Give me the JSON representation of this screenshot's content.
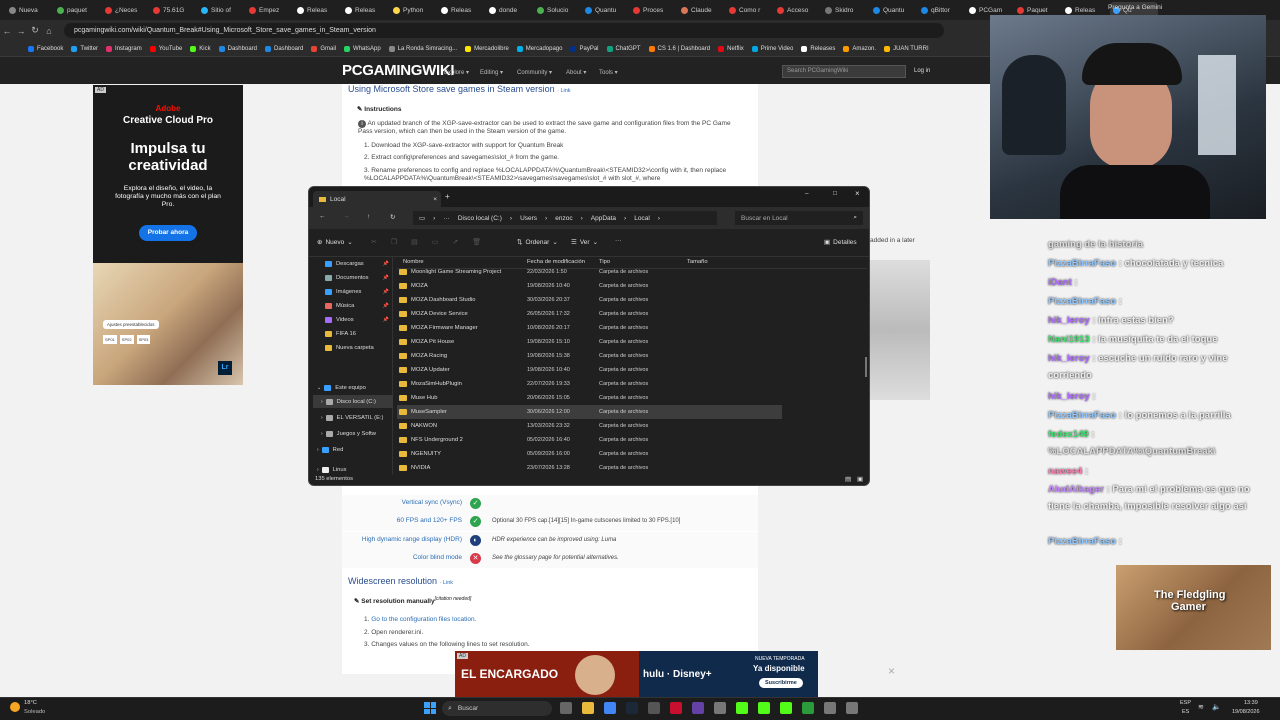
{
  "browser": {
    "tabs": [
      "Nueva",
      "paquet",
      "¿Neces",
      "75.61G",
      "Sitio of",
      "Empez",
      "Releas",
      "Releas",
      "Python",
      "Releas",
      "donde",
      "Solucio",
      "Quantu",
      "Proces",
      "Claude",
      "Como r",
      "Acceso",
      "Skidro",
      "Quantu",
      "qBittor",
      "PCGam",
      "Paquet",
      "Releas",
      "Qu"
    ],
    "gemini": "Pregunta a Gemini",
    "url": "pcgamingwiki.com/wiki/Quantum_Break#Using_Microsoft_Store_save_games_in_Steam_version",
    "bookmarks": [
      "Facebook",
      "Twitter",
      "Instagram",
      "YouTube",
      "Kick",
      "Dashboard",
      "Dashboard",
      "Gmail",
      "WhatsApp",
      "La Ronda Simracing...",
      "Mercadolibre",
      "Mercadopago",
      "PayPal",
      "ChatGPT",
      "CS 1.6 | Dashboard",
      "Netflix",
      "Prime Video",
      "Releases",
      "Amazon.",
      "JUAN TURRI"
    ]
  },
  "site": {
    "logo": "PCGAMINGWIKI",
    "nav": [
      "Explore ▾",
      "Editing ▾",
      "Community ▾",
      "About ▾",
      "Tools ▾"
    ],
    "search_placeholder": "Search PCGamingWiki",
    "login": "Log in"
  },
  "article": {
    "section_title": "Using Microsoft Store save games in Steam version",
    "section_link": "· Link",
    "instructions_title": "Instructions",
    "info": "An updated branch of the XGP-save-extractor can be used to extract the save game and configuration files from the PC Game Pass version, which can then be used in the Steam version of the game.",
    "steps": [
      "Download the XGP-save-extractor with support for Quantum Break",
      "Extract config\\preferences and savegames\\slot_# from the game.",
      "Rename preferences to config and replace %LOCALAPPDATA%\\QuantumBreak\\<STEAMID32>\\config with it, then replace %LOCALAPPDATA%\\QuantumBreak\\<STEAMID32>\\savegames\\savegames\\slot_# with slot_#, where"
    ],
    "side_note": "added in a later",
    "rows": [
      {
        "label": "Vertical sync (Vsync)",
        "icon": "check",
        "note": ""
      },
      {
        "label": "60 FPS and 120+ FPS",
        "icon": "check",
        "note": "Optional 30 FPS cap.[14][15] In-game cutscenes limited to 30 FPS.[10]"
      },
      {
        "label": "High dynamic range display (HDR)",
        "icon": "hackable",
        "note": "HDR experience can be improved using: Luma"
      },
      {
        "label": "Color blind mode",
        "icon": "cross",
        "note": "See the glossary page for potential alternatives."
      }
    ],
    "widescreen_title": "Widescreen resolution",
    "widescreen_link": "· Link",
    "set_res_title": "Set resolution manually",
    "citation": "[citation needed]",
    "ws_steps": [
      "Go to the configuration files location.",
      "Open renderer.ini.",
      "Changes values on the following lines to set resolution."
    ]
  },
  "adobe_ad": {
    "badge": "AD",
    "brand": "Adobe",
    "product": "Creative Cloud Pro",
    "headline1": "Impulsa tu",
    "headline2": "creatividad",
    "body": "Explora el diseño, el video, la fotografía y mucho más con el plan Pro.",
    "cta": "Probar ahora",
    "overlay": "Ajustes preestablecidos",
    "presets": [
      "SP01",
      "SP02",
      "SP03"
    ],
    "lr": "Lr"
  },
  "explorer": {
    "title": "Local",
    "breadcrumb": [
      "Disco local (C:)",
      "Users",
      "enzoc",
      "AppData",
      "Local"
    ],
    "search_placeholder": "Buscar en Local",
    "toolbar": {
      "new": "Nuevo",
      "sort": "Ordenar",
      "view": "Ver",
      "details": "Detalles"
    },
    "columns": [
      "Nombre",
      "Fecha de modificación",
      "Tipo",
      "Tamaño"
    ],
    "quick_access": [
      "Descargas",
      "Documentos",
      "Imágenes",
      "Música",
      "Videos",
      "FIFA 16",
      "Nueva carpeta"
    ],
    "tree": [
      "Este equipo",
      "Disco local (C:)",
      "EL VERSATIL (E:)",
      "Juegos y Softw",
      "Red",
      "Linux"
    ],
    "files": [
      {
        "name": "Moonlight Game Streaming Project",
        "date": "22/03/2026 1:50",
        "type": "Carpeta de archivos"
      },
      {
        "name": "MOZA",
        "date": "19/08/2026 10:40",
        "type": "Carpeta de archivos"
      },
      {
        "name": "MOZA Dashboard Studio",
        "date": "30/03/2026 20:37",
        "type": "Carpeta de archivos"
      },
      {
        "name": "MOZA Device Service",
        "date": "26/05/2026 17:32",
        "type": "Carpeta de archivos"
      },
      {
        "name": "MOZA Firmware Manager",
        "date": "10/08/2026 20:17",
        "type": "Carpeta de archivos"
      },
      {
        "name": "MOZA Pit House",
        "date": "19/08/2026 15:10",
        "type": "Carpeta de archivos"
      },
      {
        "name": "MOZA Racing",
        "date": "19/08/2026 15:38",
        "type": "Carpeta de archivos"
      },
      {
        "name": "MOZA Updater",
        "date": "19/08/2026 10:40",
        "type": "Carpeta de archivos"
      },
      {
        "name": "MozaSimHubPlugin",
        "date": "22/07/2026 19:33",
        "type": "Carpeta de archivos"
      },
      {
        "name": "Muse Hub",
        "date": "20/06/2026 15:05",
        "type": "Carpeta de archivos"
      },
      {
        "name": "MuseSampler",
        "date": "30/06/2026 12:00",
        "type": "Carpeta de archivos"
      },
      {
        "name": "NAKWON",
        "date": "13/03/2026 23:32",
        "type": "Carpeta de archivos"
      },
      {
        "name": "NFS Underground 2",
        "date": "05/02/2026 16:40",
        "type": "Carpeta de archivos"
      },
      {
        "name": "NGENUITY",
        "date": "05/09/2026 16:00",
        "type": "Carpeta de archivos"
      },
      {
        "name": "NVIDIA",
        "date": "23/07/2026 13:28",
        "type": "Carpeta de archivos"
      }
    ],
    "status": "135 elementos"
  },
  "chat": [
    {
      "user": "",
      "text": "gaming de la historia",
      "color": "#dddddd"
    },
    {
      "user": "PizzaBirraFaso",
      "text": ": chocolatada y tecnica",
      "color": "#8fc7ff"
    },
    {
      "user": "iDant",
      "text": ":",
      "color": "#b06cff"
    },
    {
      "user": "PizzaBirraFaso",
      "text": ":",
      "color": "#8fc7ff"
    },
    {
      "user": "hik_leroy",
      "text": ": infra estas bien?",
      "color": "#b06cff"
    },
    {
      "user": "Nani1913",
      "text": ": la musiquita te da el toque",
      "color": "#37e66a"
    },
    {
      "user": "hik_leroy",
      "text": ": escuche un ruido raro y vine corriendo",
      "color": "#b06cff"
    },
    {
      "user": "hik_leroy",
      "text": ":",
      "color": "#b06cff"
    },
    {
      "user": "PizzaBirraFaso",
      "text": ": lo ponemos a la parrilla",
      "color": "#8fc7ff"
    },
    {
      "user": "fedex149",
      "text": ":",
      "color": "#37e66a"
    },
    {
      "user": "",
      "text": "%LOCALAPPDATA%\\QuantumBreak\\",
      "color": "#dddddd"
    },
    {
      "user": "nawee4",
      "text": ":",
      "color": "#ff7ab0"
    },
    {
      "user": "AludAlkager",
      "text": ": Para mi el problema es que no tiene la chamba, imposible resolver algo asi",
      "color": "#c586ff"
    },
    {
      "user": "PizzaBirraFaso",
      "text": ":",
      "color": "#8fc7ff"
    }
  ],
  "stream_overlay": {
    "title1": "The Fledgling",
    "title2": "Gamer"
  },
  "bottom_ad": {
    "badge": "AD",
    "left": "EL ENCARGADO",
    "right_top": "NUEVA TEMPORADA",
    "right_mid": "Ya disponible",
    "cta": "Suscribirme",
    "brand": "hulu · Disney+"
  },
  "taskbar": {
    "weather_temp": "18°C",
    "weather_desc": "Soleado",
    "search": "Buscar",
    "lang1": "ESP",
    "lang2": "ES",
    "time": "13:39",
    "date": "19/08/2026"
  }
}
